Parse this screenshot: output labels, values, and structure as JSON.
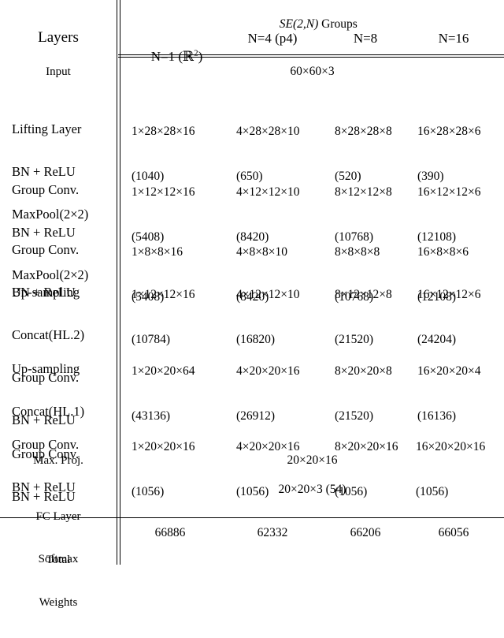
{
  "header": {
    "group_title_italic": "SE(2,N)",
    "group_title_rest": " Groups",
    "layers_label": "Layers",
    "columns": [
      {
        "label": "N=1 (ℝ²)",
        "plain": "N=1 (R2)"
      },
      {
        "label": "N=4 (p4)"
      },
      {
        "label": "N=8"
      },
      {
        "label": "N=16"
      }
    ]
  },
  "rows": [
    {
      "name": "input",
      "layer_lines": [
        "Input"
      ],
      "span": true,
      "span_value": "60×60×3"
    },
    {
      "name": "lifting-layer",
      "layer_lines": [
        "Lifting Layer",
        "BN + ReLU",
        "MaxPool(2×2)"
      ],
      "span": false,
      "cells": [
        {
          "shape": "1×28×28×16",
          "params": "(1040)"
        },
        {
          "shape": "4×28×28×10",
          "params": "(650)"
        },
        {
          "shape": "8×28×28×8",
          "params": "(520)"
        },
        {
          "shape": "16×28×28×6",
          "params": "(390)"
        }
      ]
    },
    {
      "name": "group-conv-1",
      "layer_lines": [
        "Group Conv.",
        "BN + ReLU",
        "MaxPool(2×2)"
      ],
      "span": false,
      "cells": [
        {
          "shape": "1×12×12×16",
          "params": "(5408)"
        },
        {
          "shape": "4×12×12×10",
          "params": "(8420)"
        },
        {
          "shape": "8×12×12×8",
          "params": "(10768)"
        },
        {
          "shape": "16×12×12×6",
          "params": "(12108)"
        }
      ]
    },
    {
      "name": "group-conv-2",
      "layer_lines": [
        "Group Conv.",
        "BN + ReLU"
      ],
      "span": false,
      "cells": [
        {
          "shape": "1×8×8×16",
          "params": "(5408)"
        },
        {
          "shape": "4×8×8×10",
          "params": "(8420)"
        },
        {
          "shape": "8×8×8×8",
          "params": "(10768)"
        },
        {
          "shape": "16×8×8×6",
          "params": "(12108)"
        }
      ]
    },
    {
      "name": "upsampling-hl2",
      "layer_lines": [
        "Up-sampling",
        "Concat(HL.2)",
        "Group Conv.",
        "BN + ReLU"
      ],
      "span": false,
      "cells": [
        {
          "shape": "1×12×12×16",
          "params": "(10784)"
        },
        {
          "shape": "4×12×12×10",
          "params": "(16820)"
        },
        {
          "shape": "8×12×12×8",
          "params": "(21520)"
        },
        {
          "shape": "16×12×12×6",
          "params": "(24204)"
        }
      ]
    },
    {
      "name": "upsampling-hl1",
      "layer_lines": [
        "Up-sampling",
        "Concat(HL.1)",
        "Group Conv.",
        "BN + ReLU"
      ],
      "span": false,
      "cells": [
        {
          "shape": "1×20×20×64",
          "params": "(43136)"
        },
        {
          "shape": "4×20×20×16",
          "params": "(26912)"
        },
        {
          "shape": "8×20×20×8",
          "params": "(21520)"
        },
        {
          "shape": "16×20×20×4",
          "params": "(16136)"
        }
      ]
    },
    {
      "name": "group-conv-3",
      "layer_lines": [
        "Group Conv.",
        "BN + ReLU"
      ],
      "span": false,
      "cells": [
        {
          "shape": "1×20×20×16",
          "params": "(1056)"
        },
        {
          "shape": "4×20×20×16",
          "params": "(1056)"
        },
        {
          "shape": "8×20×20×16",
          "params": "(1056)"
        },
        {
          "shape": "16×20×20×16",
          "params": "(1056)"
        }
      ]
    },
    {
      "name": "max-proj",
      "layer_lines": [
        "Max. Proj."
      ],
      "span": true,
      "span_value": "20×20×16"
    },
    {
      "name": "fc-layer",
      "layer_lines": [
        "FC Layer",
        "Softmax"
      ],
      "span": true,
      "span_value": "20×20×3 (54)"
    }
  ],
  "total": {
    "label_lines": [
      "Total",
      "Weights"
    ],
    "values": [
      "66886",
      "62332",
      "66206",
      "66056"
    ]
  }
}
